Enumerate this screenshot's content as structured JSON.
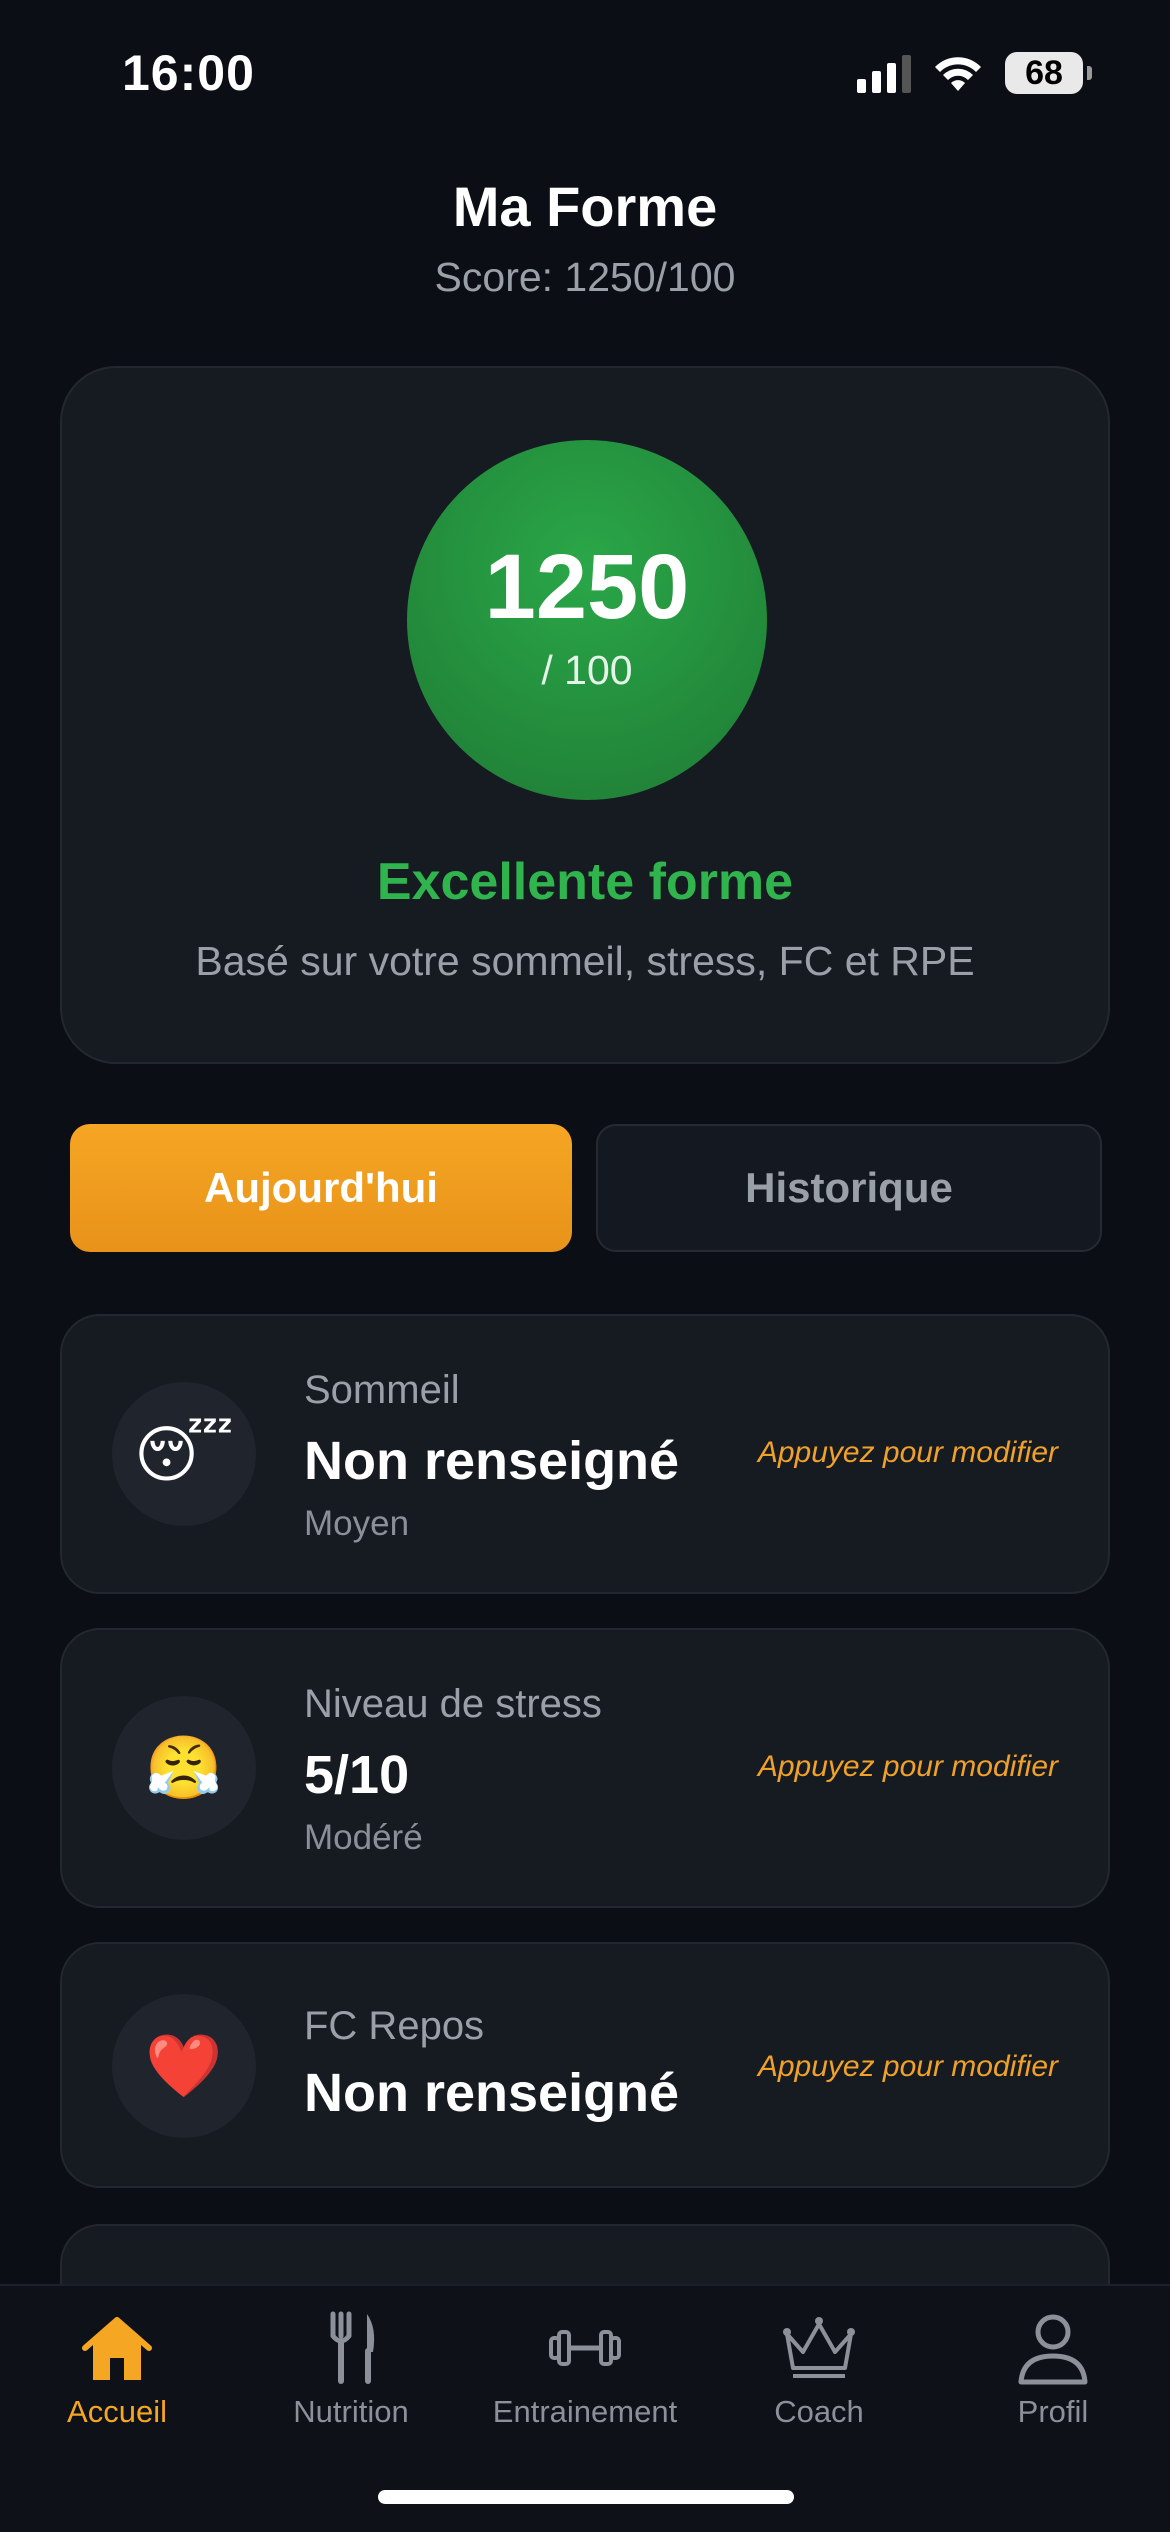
{
  "status_bar": {
    "time": "16:00",
    "battery": "68"
  },
  "header": {
    "title": "Ma Forme",
    "subtitle": "Score: 1250/100"
  },
  "score_card": {
    "value": "1250",
    "max": "/ 100",
    "status": "Excellente forme",
    "basis": "Basé sur votre sommeil, stress, FC et RPE",
    "status_color": "#2fb44e",
    "circle_color": "#238c3c"
  },
  "tabs": [
    {
      "label": "Aujourd'hui",
      "active": true
    },
    {
      "label": "Historique",
      "active": false
    }
  ],
  "metrics": [
    {
      "icon": "sleeping-face-icon",
      "emoji": "😴",
      "label": "Sommeil",
      "value": "Non renseigné",
      "sub": "Moyen",
      "edit": "Appuyez pour modifier"
    },
    {
      "icon": "steam-face-icon",
      "emoji": "😤",
      "label": "Niveau de stress",
      "value": "5/10",
      "sub": "Modéré",
      "edit": "Appuyez pour modifier"
    },
    {
      "icon": "heart-icon",
      "emoji": "❤️",
      "label": "FC Repos",
      "value": "Non renseigné",
      "sub": "",
      "edit": "Appuyez pour modifier"
    }
  ],
  "bottom_nav": [
    {
      "label": "Accueil",
      "icon": "home-icon",
      "active": true
    },
    {
      "label": "Nutrition",
      "icon": "fork-knife-icon",
      "active": false
    },
    {
      "label": "Entrainement",
      "icon": "dumbbell-icon",
      "active": false
    },
    {
      "label": "Coach",
      "icon": "crown-icon",
      "active": false
    },
    {
      "label": "Profil",
      "icon": "user-icon",
      "active": false
    }
  ],
  "colors": {
    "accent": "#f5a623",
    "background": "#0b0e14",
    "card": "#161a21"
  }
}
